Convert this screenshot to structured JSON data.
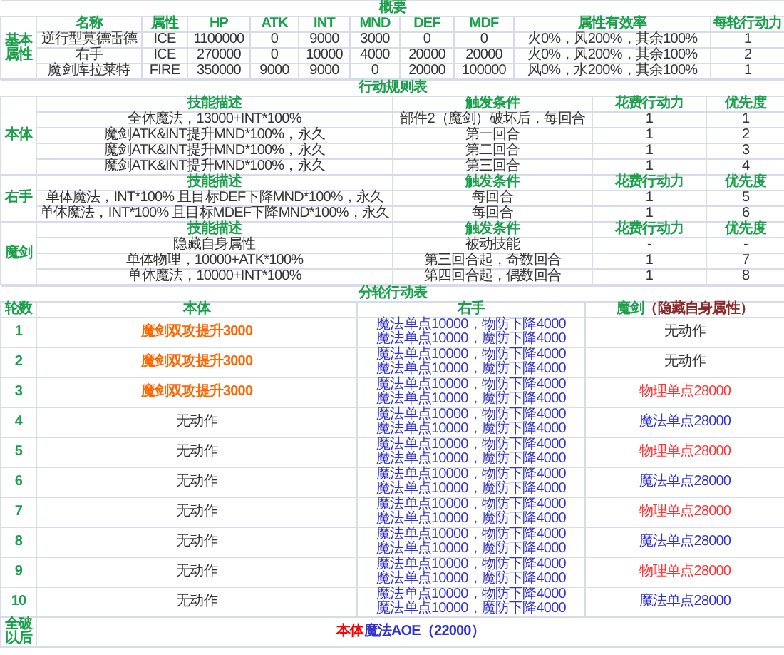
{
  "overview": {
    "title": "概要",
    "label": "基本属性",
    "columns": [
      "名称",
      "属性",
      "HP",
      "ATK",
      "INT",
      "MND",
      "DEF",
      "MDF",
      "属性有效率",
      "每轮行动力"
    ],
    "rows": [
      [
        "逆行型莫德雷德",
        "ICE",
        "1100000",
        "0",
        "9000",
        "3000",
        "0",
        "0",
        "火0%，风200%，其余100%",
        "1"
      ],
      [
        "右手",
        "ICE",
        "270000",
        "0",
        "10000",
        "4000",
        "20000",
        "20000",
        "火0%，风200%，其余100%",
        "2"
      ],
      [
        "魔剑库拉莱特",
        "FIRE",
        "350000",
        "9000",
        "9000",
        "0",
        "20000",
        "100000",
        "风0%，水200%，其余100%",
        "1"
      ]
    ]
  },
  "rules": {
    "title": "行动规则表",
    "groups": [
      {
        "label": "本体",
        "columns": [
          "技能描述",
          "触发条件",
          "花费行动力",
          "优先度"
        ],
        "rows": [
          [
            "全体魔法，13000+INT*100%",
            "部件2（魔剑）破坏后，每回合",
            "1",
            "1"
          ],
          [
            "魔剑ATK&INT提升MND*100%，永久",
            "第一回合",
            "1",
            "2"
          ],
          [
            "魔剑ATK&INT提升MND*100%，永久",
            "第二回合",
            "1",
            "3"
          ],
          [
            "魔剑ATK&INT提升MND*100%，永久",
            "第三回合",
            "1",
            "4"
          ]
        ]
      },
      {
        "label": "右手",
        "columns": [
          "技能描述",
          "触发条件",
          "花费行动力",
          "优先度"
        ],
        "rows": [
          [
            "单体魔法，INT*100% 且目标DEF下降MND*100%，永久",
            "每回合",
            "1",
            "5"
          ],
          [
            "单体魔法，INT*100% 且目标MDEF下降MND*100%，永久",
            "每回合",
            "1",
            "6"
          ]
        ]
      },
      {
        "label": "魔剑",
        "columns": [
          "技能描述",
          "触发条件",
          "花费行动力",
          "优先度"
        ],
        "rows": [
          [
            "隐藏自身属性",
            "被动技能",
            "-",
            "-"
          ],
          [
            "单体物理，10000+ATK*100%",
            "第三回合起，奇数回合",
            "1",
            "7"
          ],
          [
            "单体魔法，10000+INT*100%",
            "第四回合起，偶数回合",
            "1",
            "8"
          ]
        ]
      }
    ]
  },
  "rounds": {
    "title": "分轮行动表",
    "columns": [
      {
        "label": "轮数"
      },
      {
        "label": "本体"
      },
      {
        "label": "右手"
      },
      {
        "label": "魔剑",
        "note": "（隐藏自身属性）"
      }
    ],
    "rows": [
      {
        "round": "1",
        "body": "魔剑双攻提升3000",
        "highlighted": true,
        "right_hand": [
          "魔法单点10000，物防下降4000",
          "魔法单点10000，魔防下降4000"
        ],
        "sword": {
          "text": "无动作",
          "color": "#333333"
        }
      },
      {
        "round": "2",
        "body": "魔剑双攻提升3000",
        "highlighted": true,
        "right_hand": [
          "魔法单点10000，物防下降4000",
          "魔法单点10000，魔防下降4000"
        ],
        "sword": {
          "text": "无动作",
          "color": "#333333"
        }
      },
      {
        "round": "3",
        "body": "魔剑双攻提升3000",
        "highlighted": true,
        "right_hand": [
          "魔法单点10000，物防下降4000",
          "魔法单点10000，魔防下降4000"
        ],
        "sword": {
          "text": "物理单点28000",
          "color": "#ff3333"
        }
      },
      {
        "round": "4",
        "body": "无动作",
        "highlighted": false,
        "right_hand": [
          "魔法单点10000，物防下降4000",
          "魔法单点10000，魔防下降4000"
        ],
        "sword": {
          "text": "魔法单点28000",
          "color": "#3333cc"
        }
      },
      {
        "round": "5",
        "body": "无动作",
        "highlighted": false,
        "right_hand": [
          "魔法单点10000，物防下降4000",
          "魔法单点10000，魔防下降4000"
        ],
        "sword": {
          "text": "物理单点28000",
          "color": "#ff3333"
        }
      },
      {
        "round": "6",
        "body": "无动作",
        "highlighted": false,
        "right_hand": [
          "魔法单点10000，物防下降4000",
          "魔法单点10000，魔防下降4000"
        ],
        "sword": {
          "text": "魔法单点28000",
          "color": "#3333cc"
        }
      },
      {
        "round": "7",
        "body": "无动作",
        "highlighted": false,
        "right_hand": [
          "魔法单点10000，物防下降4000",
          "魔法单点10000，魔防下降4000"
        ],
        "sword": {
          "text": "物理单点28000",
          "color": "#ff3333"
        }
      },
      {
        "round": "8",
        "body": "无动作",
        "highlighted": false,
        "right_hand": [
          "魔法单点10000，物防下降4000",
          "魔法单点10000，魔防下降4000"
        ],
        "sword": {
          "text": "魔法单点28000",
          "color": "#3333cc"
        }
      },
      {
        "round": "9",
        "body": "无动作",
        "highlighted": false,
        "right_hand": [
          "魔法单点10000，物防下降4000",
          "魔法单点10000，魔防下降4000"
        ],
        "sword": {
          "text": "物理单点28000",
          "color": "#ff3333"
        }
      },
      {
        "round": "10",
        "body": "无动作",
        "highlighted": false,
        "right_hand": [
          "魔法单点10000，物防下降4000",
          "魔法单点10000，魔防下降4000"
        ],
        "sword": {
          "text": "魔法单点28000",
          "color": "#3333cc"
        }
      }
    ],
    "final": {
      "label": "全破以后",
      "parts": [
        {
          "text": "本体",
          "color": "#ff0000"
        },
        {
          "text": "魔法AOE（22000）",
          "color": "#3333cc"
        }
      ]
    }
  }
}
